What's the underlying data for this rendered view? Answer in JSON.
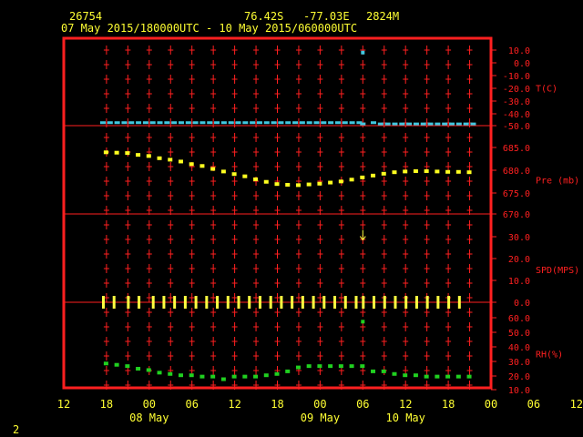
{
  "header": {
    "station_id": "26754",
    "coords": "76.42S   -77.03E",
    "elevation": "2824M",
    "time_range": "07 May 2015/180000UTC - 10 May 2015/060000UTC"
  },
  "footer": {
    "page": "2"
  },
  "colors": {
    "frame": "#ff2020",
    "text_yellow": "#ffff33",
    "temperature": "#40c8e0",
    "pressure": "#ffff20",
    "wind": "#ffff40",
    "rh": "#20d020"
  },
  "chart_data": [
    {
      "type": "scatter",
      "panel": "temperature",
      "ylabel": "T(C)",
      "ticks": [
        "10.0",
        "0.0",
        "-10.0",
        "-20.0",
        "-30.0",
        "-40.0",
        "-50.0"
      ],
      "ylim": [
        -50,
        10
      ],
      "series": [
        {
          "x": [
            17.5,
            18.5,
            19.5,
            20.5,
            21.5,
            22.5,
            23.5,
            24.5,
            25.5,
            26.5,
            27.5,
            28.5,
            29.5,
            30.5,
            31.5,
            32.5,
            33.5,
            34.5,
            35.5,
            36.5,
            37.5,
            38.5,
            39.5,
            40.5,
            41.5,
            42.5,
            43.5,
            44.5,
            45.5,
            46.5,
            47.5,
            48.5,
            49.5,
            50.5,
            51.5,
            52.5,
            53.5,
            54,
            55.5,
            56.5,
            57.5,
            58.5,
            59.5,
            60.5,
            61.5,
            62.5,
            63.5,
            64.5,
            65.5,
            66.5,
            67.5,
            68.5,
            69.5
          ],
          "y": [
            -48,
            -48,
            -48,
            -48,
            -48,
            -48,
            -48,
            -48,
            -48,
            -48,
            -48,
            -48,
            -48,
            -48,
            -48,
            -48,
            -48,
            -48,
            -48,
            -48,
            -48,
            -48,
            -48,
            -48,
            -48,
            -48,
            -48,
            -48,
            -48,
            -48,
            -48,
            -48,
            -48,
            -48,
            -48,
            -48,
            -48,
            -49,
            -48,
            -49,
            -49,
            -49,
            -49,
            -49,
            -49,
            -49,
            -49,
            -49,
            -49,
            -49,
            -49,
            -49,
            -49
          ]
        },
        {
          "x": [
            54
          ],
          "y": [
            8
          ]
        }
      ]
    },
    {
      "type": "scatter",
      "panel": "pressure",
      "ylabel": "Pre (mb)",
      "ticks": [
        "685.0",
        "680.0",
        "675.0",
        "670.0"
      ],
      "ylim": [
        670,
        688.5
      ],
      "series": [
        {
          "x": [
            18,
            19.5,
            21,
            22.5,
            24,
            25.5,
            27,
            28.5,
            30,
            31.5,
            33,
            34.5,
            36,
            37.5,
            39,
            40.5,
            42,
            43.5,
            45,
            46.5,
            48,
            49.5,
            51,
            52.5,
            54,
            55.5,
            57,
            58.5,
            60,
            61.5,
            63,
            64.5,
            66,
            67.5,
            69
          ],
          "y": [
            686.7,
            686.6,
            686.5,
            686.0,
            685.7,
            685.1,
            684.7,
            684.2,
            683.5,
            683.0,
            682.2,
            681.5,
            680.8,
            680.2,
            679.4,
            678.7,
            678.1,
            677.9,
            677.8,
            678.0,
            678.2,
            678.5,
            678.8,
            679.3,
            679.9,
            680.4,
            680.9,
            681.3,
            681.5,
            681.6,
            681.6,
            681.5,
            681.4,
            681.4,
            681.3
          ]
        }
      ]
    },
    {
      "type": "scatter",
      "panel": "wind",
      "ylabel": "SPD(MPS)",
      "ticks": [
        "30.0",
        "20.0",
        "10.0",
        "0.0"
      ],
      "ylim": [
        0,
        30
      ],
      "series": [
        {
          "x": [
            17.5,
            19,
            21,
            22.5,
            24.5,
            26,
            27.5,
            29,
            30.5,
            32,
            33.5,
            35,
            36.5,
            38,
            39.5,
            41,
            42.5,
            44,
            45.5,
            47,
            48.5,
            50,
            51.5,
            53,
            54,
            55.5,
            57,
            58.5,
            60,
            61.5,
            63,
            64.5,
            66,
            67.5
          ],
          "y": [
            0,
            0,
            0,
            0,
            0,
            0,
            0,
            0,
            0,
            0,
            0,
            0,
            0,
            0,
            0,
            0,
            0,
            0,
            0,
            0,
            0,
            0,
            0,
            0,
            0,
            0,
            0,
            0,
            0,
            0,
            0,
            0,
            0,
            0
          ]
        }
      ],
      "arrow_marker": {
        "x": 54,
        "speed": 31
      }
    },
    {
      "type": "scatter",
      "panel": "rh",
      "ylabel": "RH(%)",
      "ticks": [
        "60.0",
        "50.0",
        "40.0",
        "30.0",
        "20.0",
        "10.0"
      ],
      "ylim": [
        10,
        65
      ],
      "series": [
        {
          "x": [
            18,
            19.5,
            21,
            22.5,
            24,
            25.5,
            27,
            28.5,
            30,
            31.5,
            33,
            34.5,
            36,
            37.5,
            39,
            40.5,
            42,
            43.5,
            45,
            46.5,
            48,
            49.5,
            51,
            52.5,
            54,
            55.5,
            57,
            58.5,
            60,
            61.5,
            63,
            64.5,
            66,
            67.5,
            69
          ],
          "y": [
            30,
            29,
            28,
            26,
            25,
            23,
            22,
            21,
            21,
            20,
            20,
            18,
            20,
            20,
            20,
            21,
            22,
            24,
            27,
            28,
            28,
            28,
            28,
            28,
            28,
            24,
            24,
            22,
            21,
            21,
            20,
            20,
            20,
            20,
            20
          ],
          "extra_point": {
            "x": 54,
            "y": 62
          }
        }
      ]
    }
  ],
  "xaxis": {
    "hours": [
      "12",
      "18",
      "00",
      "06",
      "12",
      "18",
      "00",
      "06",
      "12",
      "18",
      "00",
      "06",
      "12"
    ],
    "days": [
      "08 May",
      "09 May",
      "10 May"
    ]
  }
}
